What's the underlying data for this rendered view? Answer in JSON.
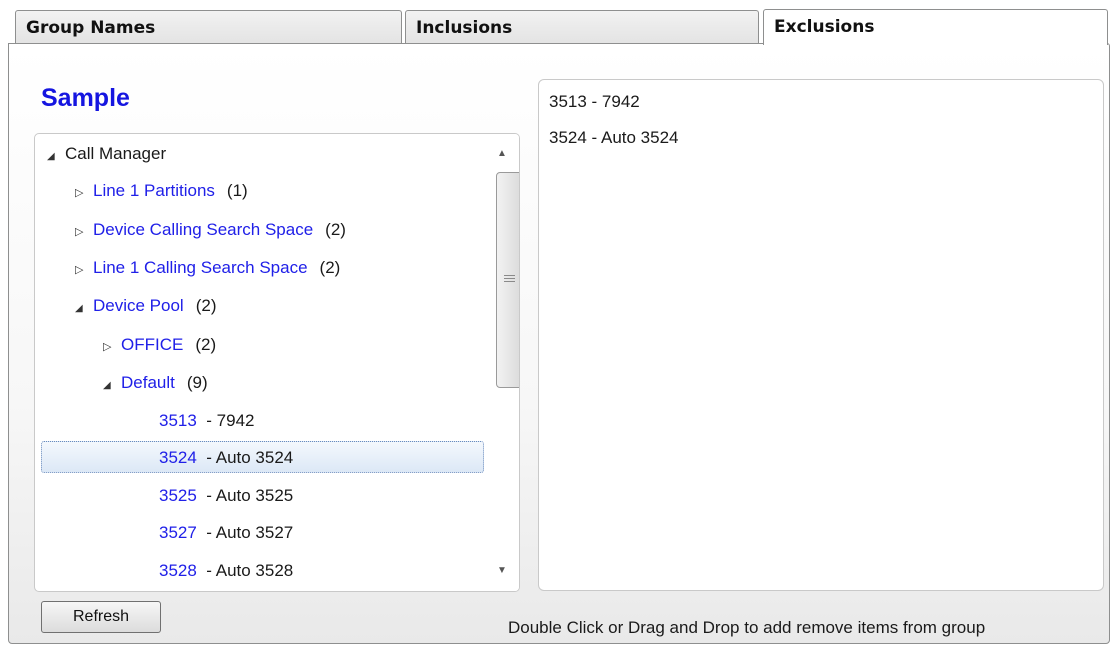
{
  "tabs": [
    {
      "label": "Group Names",
      "active": false
    },
    {
      "label": "Inclusions",
      "active": false
    },
    {
      "label": "Exclusions",
      "active": true
    }
  ],
  "group_title": "Sample",
  "tree": {
    "root": "Call Manager",
    "nodes": [
      {
        "label": "Line 1 Partitions",
        "count": "(1)",
        "expanded": false
      },
      {
        "label": "Device Calling Search Space",
        "count": "(2)",
        "expanded": false
      },
      {
        "label": "Line 1 Calling Search Space",
        "count": "(2)",
        "expanded": false
      },
      {
        "label": "Device Pool",
        "count": "(2)",
        "expanded": true
      },
      {
        "label": "OFFICE",
        "count": "(2)",
        "expanded": false
      },
      {
        "label": "Default",
        "count": "(9)",
        "expanded": true
      }
    ],
    "leaves": [
      {
        "number": "3513",
        "desc": "- 7942"
      },
      {
        "number": "3524",
        "desc": "- Auto 3524",
        "selected": true
      },
      {
        "number": "3525",
        "desc": "- Auto 3525"
      },
      {
        "number": "3527",
        "desc": "- Auto 3527"
      },
      {
        "number": "3528",
        "desc": "- Auto 3528"
      }
    ]
  },
  "exclusions_list": [
    "3513 - 7942",
    "3524 - Auto 3524"
  ],
  "refresh_label": "Refresh",
  "hint_text": "Double Click or Drag and Drop to add remove items from group"
}
